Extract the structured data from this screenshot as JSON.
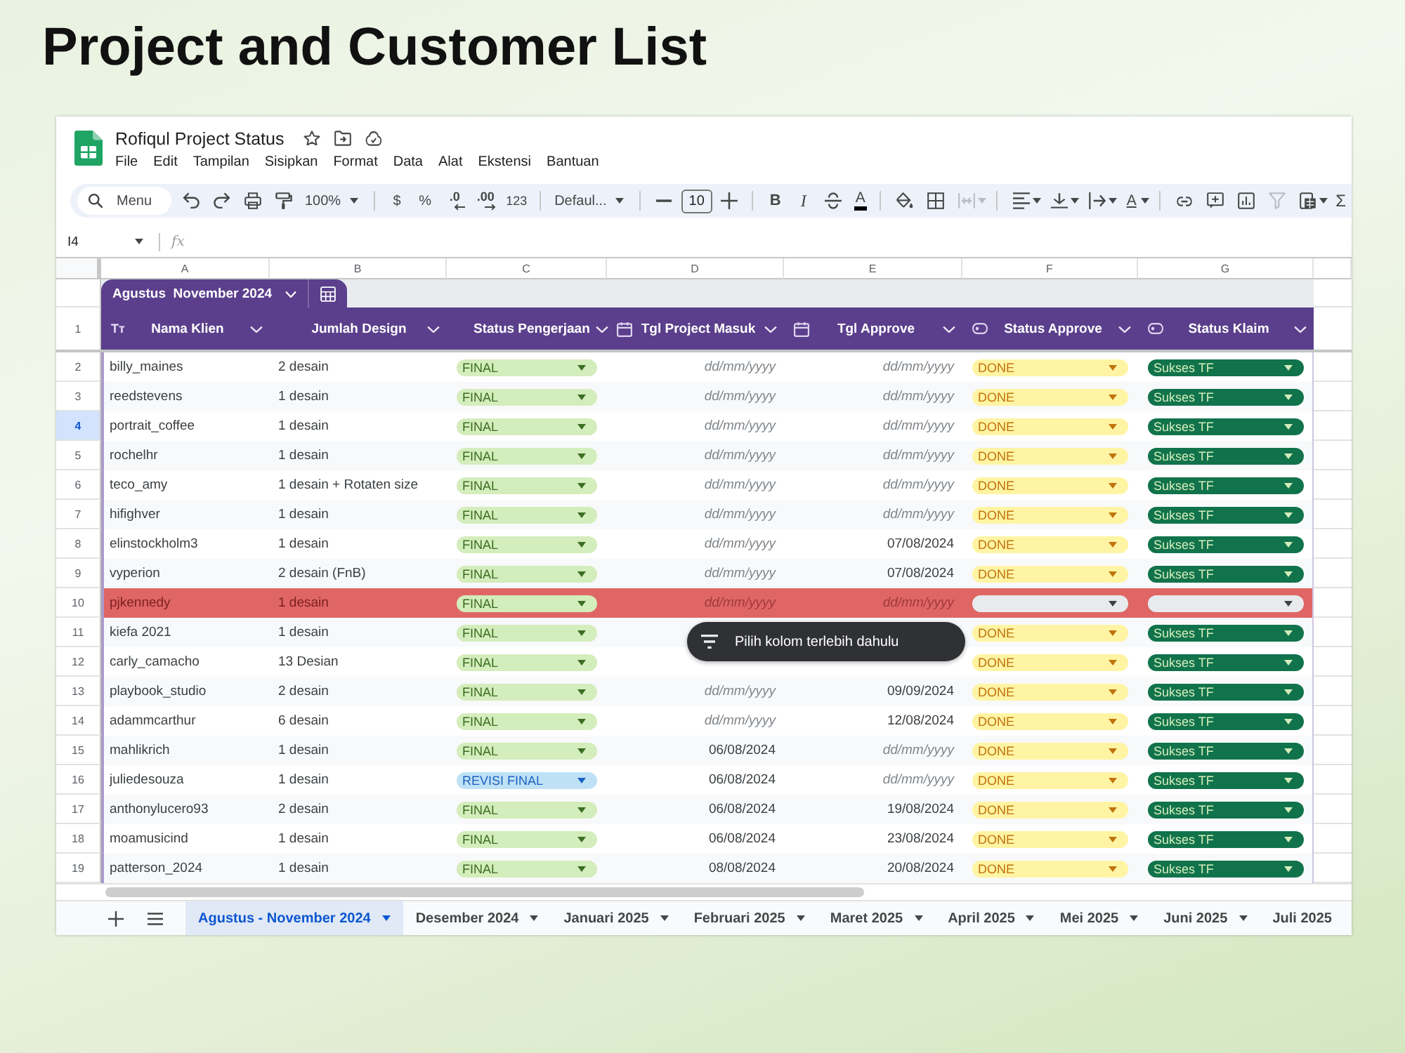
{
  "heading": "Project and Customer List",
  "document": {
    "title": "Rofiqul Project Status",
    "menu": [
      "File",
      "Edit",
      "Tampilan",
      "Sisipkan",
      "Format",
      "Data",
      "Alat",
      "Ekstensi",
      "Bantuan"
    ]
  },
  "toolbar": {
    "groups": [
      [
        {
          "kind": "search",
          "label": "Menu",
          "disabled": false
        },
        {
          "kind": "undo",
          "disabled": false
        },
        {
          "kind": "redo",
          "disabled": false
        },
        {
          "kind": "print",
          "disabled": false
        },
        {
          "kind": "paint",
          "disabled": false
        },
        {
          "kind": "zoom",
          "label": "100%",
          "disabled": false
        }
      ],
      [
        {
          "kind": "currency",
          "label": "$",
          "disabled": false
        },
        {
          "kind": "percent",
          "label": "%",
          "disabled": false
        },
        {
          "kind": "decrease",
          "label": ".0",
          "disabled": false
        },
        {
          "kind": "increase",
          "label": ".00",
          "disabled": false
        },
        {
          "kind": "numformat",
          "label": "123",
          "disabled": false
        }
      ],
      [
        {
          "kind": "font",
          "label": "Defaul...",
          "disabled": false
        }
      ],
      [
        {
          "kind": "minus",
          "disabled": false
        },
        {
          "kind": "size",
          "label": "10",
          "disabled": false
        },
        {
          "kind": "plus",
          "disabled": false
        }
      ],
      [
        {
          "kind": "bold",
          "label": "B",
          "disabled": false
        },
        {
          "kind": "italic",
          "label": "I",
          "disabled": false
        },
        {
          "kind": "strike",
          "disabled": false
        },
        {
          "kind": "color",
          "label": "A",
          "disabled": false
        }
      ],
      [
        {
          "kind": "fill",
          "disabled": false
        },
        {
          "kind": "borders",
          "disabled": false
        },
        {
          "kind": "merge",
          "disabled": true
        }
      ],
      [
        {
          "kind": "align",
          "disabled": false
        },
        {
          "kind": "valign",
          "disabled": false
        },
        {
          "kind": "wrap",
          "disabled": false
        },
        {
          "kind": "rotate",
          "label": "A",
          "disabled": false
        }
      ],
      [
        {
          "kind": "link",
          "disabled": false
        },
        {
          "kind": "comment",
          "disabled": false
        },
        {
          "kind": "chart",
          "disabled": false
        },
        {
          "kind": "filter",
          "disabled": true
        },
        {
          "kind": "views",
          "disabled": false
        },
        {
          "kind": "sum",
          "label": "Σ",
          "disabled": false
        }
      ]
    ]
  },
  "formula_bar": {
    "cell": "I4",
    "fx": "fx"
  },
  "column_letters": [
    "A",
    "B",
    "C",
    "D",
    "E",
    "F",
    "G"
  ],
  "table": {
    "name": "Agustus  November 2024",
    "header_row_number": "1",
    "columns": [
      {
        "title": "Nama Klien",
        "kind": "text",
        "glyph": "Tт"
      },
      {
        "title": "Jumlah Design",
        "kind": "plain"
      },
      {
        "title": "Status Pengerjaan",
        "kind": "plain"
      },
      {
        "title": "Tgl Project Masuk",
        "kind": "date"
      },
      {
        "title": "Tgl Approve",
        "kind": "date"
      },
      {
        "title": "Status Approve",
        "kind": "chip"
      },
      {
        "title": "Status Klaim",
        "kind": "chip"
      }
    ],
    "rows": [
      {
        "number": "2",
        "selected": false,
        "highlighted": false,
        "cells": [
          {
            "text": "billy_maines"
          },
          {
            "text": "2 desain"
          },
          {
            "label": "FINAL",
            "color": "#d4edbc"
          },
          {
            "placeholder": "dd/mm/yyyy"
          },
          {
            "placeholder": "dd/mm/yyyy"
          },
          {
            "label": "DONE",
            "color": "#fff4a3"
          },
          {
            "label": "Sukses TF",
            "color": "#11734b"
          }
        ]
      },
      {
        "number": "3",
        "selected": false,
        "highlighted": false,
        "cells": [
          {
            "text": "reedstevens"
          },
          {
            "text": "1 desain"
          },
          {
            "label": "FINAL",
            "color": "#d4edbc"
          },
          {
            "placeholder": "dd/mm/yyyy"
          },
          {
            "placeholder": "dd/mm/yyyy"
          },
          {
            "label": "DONE",
            "color": "#fff4a3"
          },
          {
            "label": "Sukses TF",
            "color": "#11734b"
          }
        ]
      },
      {
        "number": "4",
        "selected": true,
        "highlighted": false,
        "cells": [
          {
            "text": "portrait_coffee"
          },
          {
            "text": "1 desain"
          },
          {
            "label": "FINAL",
            "color": "#d4edbc"
          },
          {
            "placeholder": "dd/mm/yyyy"
          },
          {
            "placeholder": "dd/mm/yyyy"
          },
          {
            "label": "DONE",
            "color": "#fff4a3"
          },
          {
            "label": "Sukses TF",
            "color": "#11734b"
          }
        ]
      },
      {
        "number": "5",
        "selected": false,
        "highlighted": false,
        "cells": [
          {
            "text": "rochelhr"
          },
          {
            "text": "1 desain"
          },
          {
            "label": "FINAL",
            "color": "#d4edbc"
          },
          {
            "placeholder": "dd/mm/yyyy"
          },
          {
            "placeholder": "dd/mm/yyyy"
          },
          {
            "label": "DONE",
            "color": "#fff4a3"
          },
          {
            "label": "Sukses TF",
            "color": "#11734b"
          }
        ]
      },
      {
        "number": "6",
        "selected": false,
        "highlighted": false,
        "cells": [
          {
            "text": "teco_amy"
          },
          {
            "text": "1 desain + Rotaten size"
          },
          {
            "label": "FINAL",
            "color": "#d4edbc"
          },
          {
            "placeholder": "dd/mm/yyyy"
          },
          {
            "placeholder": "dd/mm/yyyy"
          },
          {
            "label": "DONE",
            "color": "#fff4a3"
          },
          {
            "label": "Sukses TF",
            "color": "#11734b"
          }
        ]
      },
      {
        "number": "7",
        "selected": false,
        "highlighted": false,
        "cells": [
          {
            "text": "hifighver"
          },
          {
            "text": "1 desain"
          },
          {
            "label": "FINAL",
            "color": "#d4edbc"
          },
          {
            "placeholder": "dd/mm/yyyy"
          },
          {
            "placeholder": "dd/mm/yyyy"
          },
          {
            "label": "DONE",
            "color": "#fff4a3"
          },
          {
            "label": "Sukses TF",
            "color": "#11734b"
          }
        ]
      },
      {
        "number": "8",
        "selected": false,
        "highlighted": false,
        "cells": [
          {
            "text": "elinstockholm3"
          },
          {
            "text": "1 desain"
          },
          {
            "label": "FINAL",
            "color": "#d4edbc"
          },
          {
            "placeholder": "dd/mm/yyyy"
          },
          {
            "text": "07/08/2024"
          },
          {
            "label": "DONE",
            "color": "#fff4a3"
          },
          {
            "label": "Sukses TF",
            "color": "#11734b"
          }
        ]
      },
      {
        "number": "9",
        "selected": false,
        "highlighted": false,
        "cells": [
          {
            "text": "vyperion"
          },
          {
            "text": "2 desain (FnB)"
          },
          {
            "label": "FINAL",
            "color": "#d4edbc"
          },
          {
            "placeholder": "dd/mm/yyyy"
          },
          {
            "text": "07/08/2024"
          },
          {
            "label": "DONE",
            "color": "#fff4a3"
          },
          {
            "label": "Sukses TF",
            "color": "#11734b"
          }
        ]
      },
      {
        "number": "10",
        "selected": false,
        "highlighted": true,
        "cells": [
          {
            "text": "pjkennedy"
          },
          {
            "text": "1 desain"
          },
          {
            "label": "FINAL",
            "color": "#d4edbc"
          },
          {
            "placeholder": "dd/mm/yyyy"
          },
          {
            "placeholder": "dd/mm/yyyy"
          },
          {
            "color": "#e8eaed"
          },
          {
            "color": "#e8eaed"
          }
        ]
      },
      {
        "number": "11",
        "selected": false,
        "highlighted": false,
        "cells": [
          {
            "text": "kiefa 2021"
          },
          {
            "text": "1 desain"
          },
          {
            "label": "FINAL",
            "color": "#d4edbc"
          },
          null,
          null,
          {
            "label": "DONE",
            "color": "#fff4a3"
          },
          {
            "label": "Sukses TF",
            "color": "#11734b"
          }
        ]
      },
      {
        "number": "12",
        "selected": false,
        "highlighted": false,
        "cells": [
          {
            "text": "carly_camacho"
          },
          {
            "text": "13 Desian"
          },
          {
            "label": "FINAL",
            "color": "#d4edbc"
          },
          null,
          null,
          {
            "label": "DONE",
            "color": "#fff4a3"
          },
          {
            "label": "Sukses TF",
            "color": "#11734b"
          }
        ]
      },
      {
        "number": "13",
        "selected": false,
        "highlighted": false,
        "cells": [
          {
            "text": "playbook_studio"
          },
          {
            "text": "2 desain"
          },
          {
            "label": "FINAL",
            "color": "#d4edbc"
          },
          {
            "placeholder": "dd/mm/yyyy"
          },
          {
            "text": "09/09/2024"
          },
          {
            "label": "DONE",
            "color": "#fff4a3"
          },
          {
            "label": "Sukses TF",
            "color": "#11734b"
          }
        ]
      },
      {
        "number": "14",
        "selected": false,
        "highlighted": false,
        "cells": [
          {
            "text": "adammcarthur"
          },
          {
            "text": "6 desain"
          },
          {
            "label": "FINAL",
            "color": "#d4edbc"
          },
          {
            "placeholder": "dd/mm/yyyy"
          },
          {
            "text": "12/08/2024"
          },
          {
            "label": "DONE",
            "color": "#fff4a3"
          },
          {
            "label": "Sukses TF",
            "color": "#11734b"
          }
        ]
      },
      {
        "number": "15",
        "selected": false,
        "highlighted": false,
        "cells": [
          {
            "text": "mahlikrich"
          },
          {
            "text": "1 desain"
          },
          {
            "label": "FINAL",
            "color": "#d4edbc"
          },
          {
            "text": "06/08/2024"
          },
          {
            "placeholder": "dd/mm/yyyy"
          },
          {
            "label": "DONE",
            "color": "#fff4a3"
          },
          {
            "label": "Sukses TF",
            "color": "#11734b"
          }
        ]
      },
      {
        "number": "16",
        "selected": false,
        "highlighted": false,
        "cells": [
          {
            "text": "juliedesouza"
          },
          {
            "text": "1 desain"
          },
          {
            "label": "REVISI FINAL",
            "color": "#bfe1f6"
          },
          {
            "text": "06/08/2024"
          },
          {
            "placeholder": "dd/mm/yyyy"
          },
          {
            "label": "DONE",
            "color": "#fff4a3"
          },
          {
            "label": "Sukses TF",
            "color": "#11734b"
          }
        ]
      },
      {
        "number": "17",
        "selected": false,
        "highlighted": false,
        "cells": [
          {
            "text": "anthonylucero93"
          },
          {
            "text": "2 desain"
          },
          {
            "label": "FINAL",
            "color": "#d4edbc"
          },
          {
            "text": "06/08/2024"
          },
          {
            "text": "19/08/2024"
          },
          {
            "label": "DONE",
            "color": "#fff4a3"
          },
          {
            "label": "Sukses TF",
            "color": "#11734b"
          }
        ]
      },
      {
        "number": "18",
        "selected": false,
        "highlighted": false,
        "cells": [
          {
            "text": "moamusicind"
          },
          {
            "text": "1 desain"
          },
          {
            "label": "FINAL",
            "color": "#d4edbc"
          },
          {
            "text": "06/08/2024"
          },
          {
            "text": "23/08/2024"
          },
          {
            "label": "DONE",
            "color": "#fff4a3"
          },
          {
            "label": "Sukses TF",
            "color": "#11734b"
          }
        ]
      },
      {
        "number": "19",
        "selected": false,
        "highlighted": false,
        "cells": [
          {
            "text": "patterson_2024"
          },
          {
            "text": "1 desain"
          },
          {
            "label": "FINAL",
            "color": "#d4edbc"
          },
          {
            "text": "08/08/2024"
          },
          {
            "text": "20/08/2024"
          },
          {
            "label": "DONE",
            "color": "#fff4a3"
          },
          {
            "label": "Sukses TF",
            "color": "#11734b"
          }
        ]
      }
    ]
  },
  "tooltip": {
    "text": "Pilih kolom terlebih dahulu"
  },
  "sheet_tabs": [
    {
      "label": "Agustus - November 2024",
      "selected": true,
      "caret": true
    },
    {
      "label": "Desember 2024",
      "selected": false,
      "caret": true
    },
    {
      "label": "Januari 2025",
      "selected": false,
      "caret": true
    },
    {
      "label": "Februari 2025",
      "selected": false,
      "caret": true
    },
    {
      "label": "Maret 2025",
      "selected": false,
      "caret": true
    },
    {
      "label": "April 2025",
      "selected": false,
      "caret": true
    },
    {
      "label": "Mei 2025",
      "selected": false,
      "caret": true
    },
    {
      "label": "Juni 2025",
      "selected": false,
      "caret": true
    },
    {
      "label": "Juli 2025",
      "selected": false,
      "caret": false
    }
  ]
}
